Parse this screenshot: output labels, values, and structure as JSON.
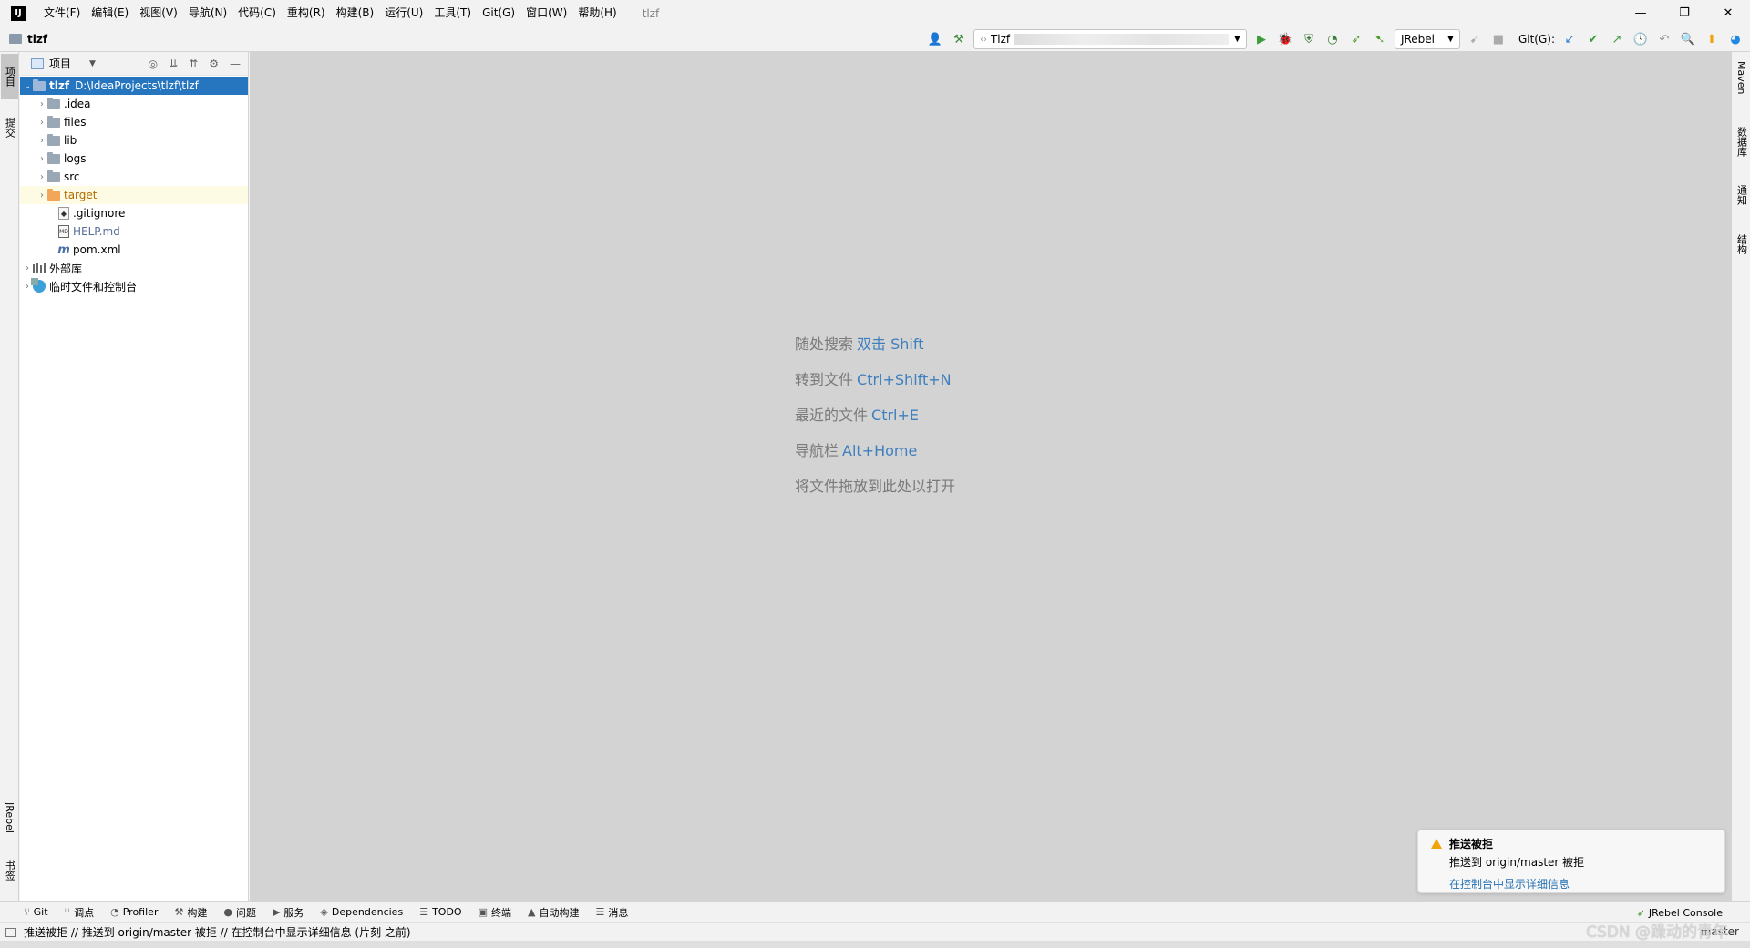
{
  "app": {
    "logo": "IJ",
    "window_title": "tlzf"
  },
  "menu": [
    "文件(F)",
    "编辑(E)",
    "视图(V)",
    "导航(N)",
    "代码(C)",
    "重构(R)",
    "构建(B)",
    "运行(U)",
    "工具(T)",
    "Git(G)",
    "窗口(W)",
    "帮助(H)"
  ],
  "window_controls": {
    "minimize": "—",
    "restore": "❐",
    "close": "✕"
  },
  "navbar": {
    "project": "tlzf",
    "run_config": "Tlzf",
    "jrebel_select": "JRebel",
    "git_label": "Git(G):"
  },
  "left_stripe": {
    "project_tab": "项目",
    "commit_tab": "提交",
    "jrebel_tab": "JRebel",
    "bookmarks_tab": "书签"
  },
  "project_panel": {
    "title": "项目",
    "root_name": "tlzf",
    "root_path": "D:\\IdeaProjects\\tlzf\\tlzf",
    "items": [
      {
        "name": ".idea",
        "type": "folder"
      },
      {
        "name": "files",
        "type": "folder"
      },
      {
        "name": "lib",
        "type": "folder"
      },
      {
        "name": "logs",
        "type": "folder"
      },
      {
        "name": "src",
        "type": "folder"
      },
      {
        "name": "target",
        "type": "folder-excluded"
      },
      {
        "name": ".gitignore",
        "type": "file"
      },
      {
        "name": "HELP.md",
        "type": "md"
      },
      {
        "name": "pom.xml",
        "type": "maven"
      }
    ],
    "external_libs": "外部库",
    "scratches": "临时文件和控制台"
  },
  "editor": {
    "hints": [
      {
        "text": "随处搜索",
        "key": "双击 Shift"
      },
      {
        "text": "转到文件",
        "key": "Ctrl+Shift+N"
      },
      {
        "text": "最近的文件",
        "key": "Ctrl+E"
      },
      {
        "text": "导航栏",
        "key": "Alt+Home"
      },
      {
        "text": "将文件拖放到此处以打开",
        "key": ""
      }
    ]
  },
  "right_stripe": {
    "maven": "Maven",
    "database": "数据库",
    "notifications": "通知",
    "structure": "结构"
  },
  "notification": {
    "title": "推送被拒",
    "body": "推送到 origin/master 被拒",
    "link": "在控制台中显示详细信息"
  },
  "bottom_tools": [
    {
      "label": "Git",
      "icon": "⑂"
    },
    {
      "label": "调点",
      "icon": "⑂"
    },
    {
      "label": "Profiler",
      "icon": "◔"
    },
    {
      "label": "构建",
      "icon": "⚒"
    },
    {
      "label": "问题",
      "icon": "●"
    },
    {
      "label": "服务",
      "icon": "▶"
    },
    {
      "label": "Dependencies",
      "icon": "◈"
    },
    {
      "label": "TODO",
      "icon": "☰"
    },
    {
      "label": "终端",
      "icon": "▣"
    },
    {
      "label": "自动构建",
      "icon": "▲"
    },
    {
      "label": "消息",
      "icon": "☰"
    }
  ],
  "jrebel_console": "JRebel Console",
  "status": {
    "message": "推送被拒 // 推送到 origin/master 被拒 // 在控制台中显示详细信息 (片刻 之前)",
    "branch": "master",
    "watermark": "CSDN @躁动的青年"
  }
}
